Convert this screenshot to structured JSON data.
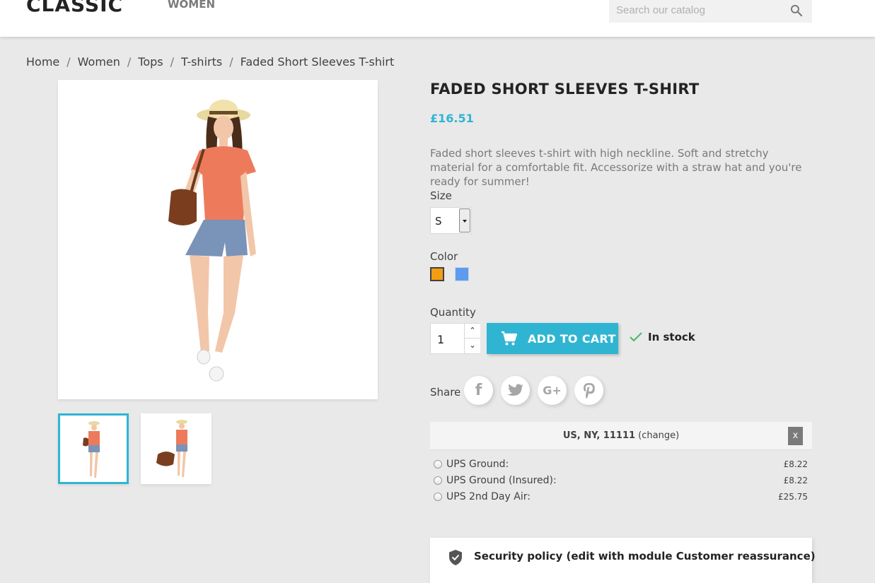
{
  "header": {
    "logo": "CLASSIC",
    "nav": [
      "WOMEN"
    ],
    "search_placeholder": "Search our catalog"
  },
  "breadcrumb": [
    "Home",
    "Women",
    "Tops",
    "T-shirts",
    "Faded Short Sleeves T-shirt"
  ],
  "product": {
    "title": "FADED SHORT SLEEVES T-SHIRT",
    "price": "£16.51",
    "description": "Faded short sleeves t-shirt with high neckline. Soft and stretchy material for a comfortable fit. Accessorize with a straw hat and you're ready for summer!",
    "size_label": "Size",
    "size_value": "S",
    "color_label": "Color",
    "colors": [
      "#f39d12",
      "#5d9cec"
    ],
    "quantity_label": "Quantity",
    "quantity_value": "1",
    "add_to_cart": "ADD TO CART",
    "stock": "In stock"
  },
  "share": {
    "label": "Share",
    "networks": [
      "facebook-icon",
      "twitter-icon",
      "googleplus-icon",
      "pinterest-icon"
    ]
  },
  "shipping": {
    "location": "US, NY, 11111",
    "change": "(change)",
    "close": "x",
    "options": [
      {
        "name": "UPS Ground:",
        "cost": "£8.22"
      },
      {
        "name": "UPS Ground (Insured):",
        "cost": "£8.22"
      },
      {
        "name": "UPS 2nd Day Air:",
        "cost": "£25.75"
      }
    ]
  },
  "reassurance": {
    "text": "Security policy (edit with module Customer reassurance)"
  },
  "colors": {
    "accent": "#2fb5d2",
    "background": "#e9e9e9"
  }
}
